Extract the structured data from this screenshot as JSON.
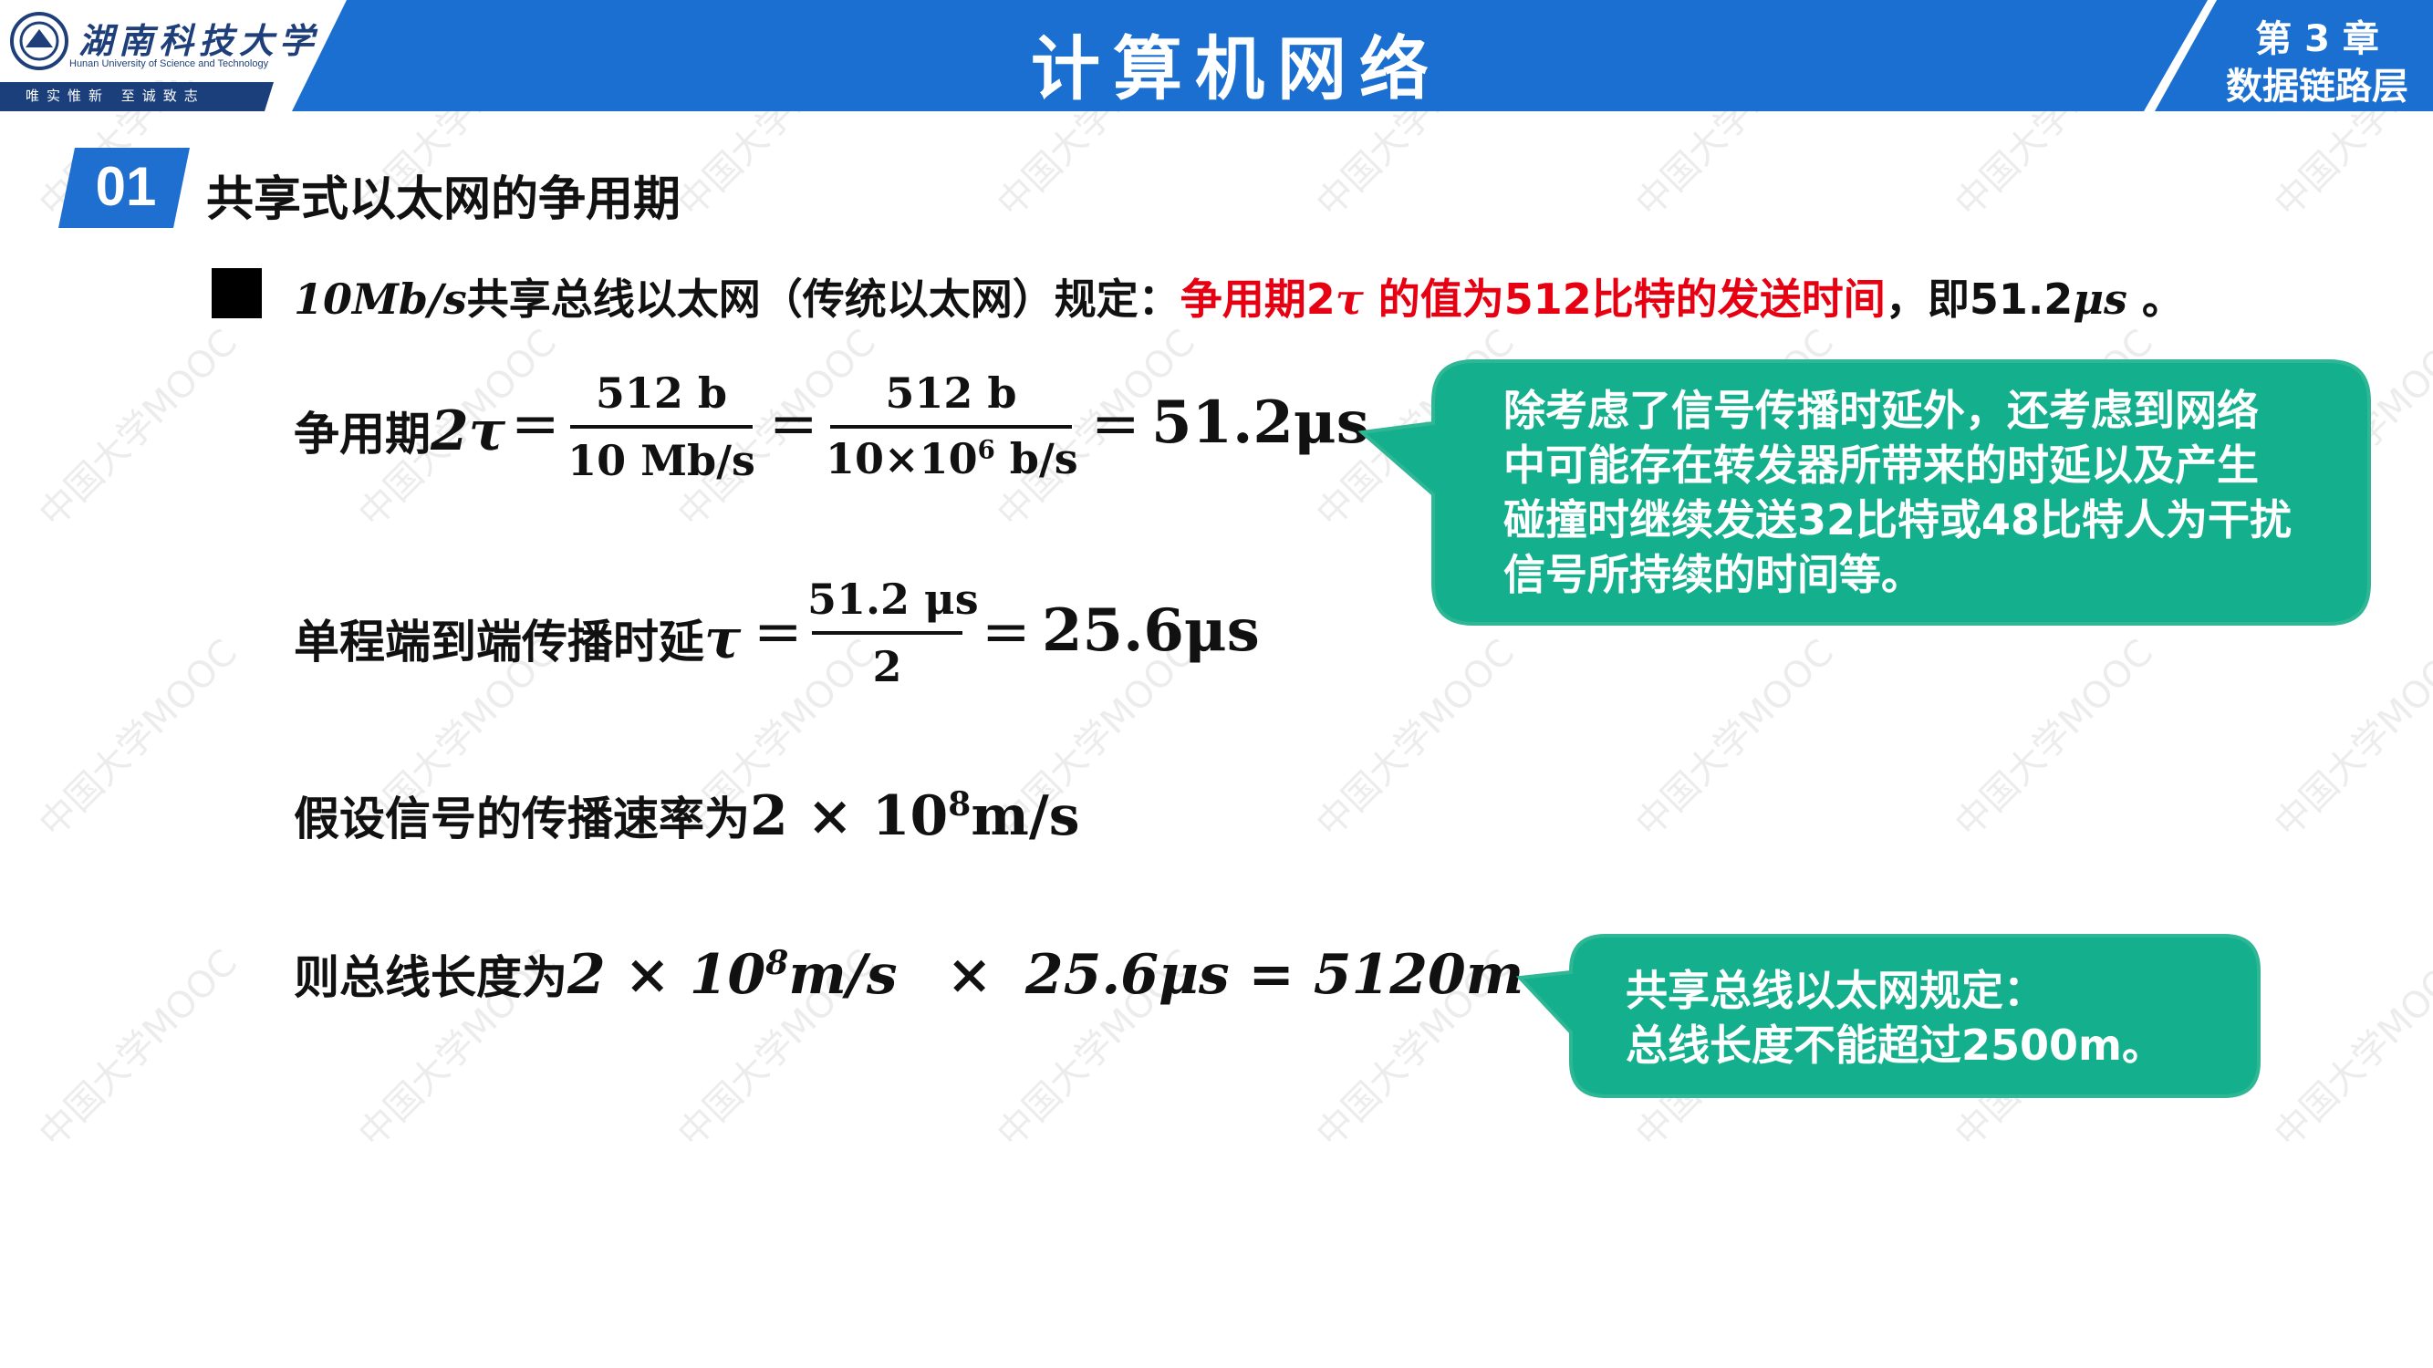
{
  "header": {
    "university_name_cn": "湖南科技大学",
    "university_name_en": "Hunan University of Science and Technology",
    "motto": "唯实惟新 至诚致志",
    "course_title": "计算机网络",
    "chapter_number": "第 3 章",
    "chapter_name": "数据链路层"
  },
  "section": {
    "number": "01",
    "title": "共享式以太网的争用期"
  },
  "bullet": {
    "prefix_math": "10Mb/s",
    "prefix_text": "共享总线以太网（传统以太网）规定：",
    "highlight_text_a": "争用期2",
    "highlight_tau": "τ",
    "highlight_text_b": " 的值为512比特的发送时间",
    "suffix_text": "，即51.2",
    "suffix_unit": "μs",
    "end": " 。"
  },
  "eq1": {
    "label": "争用期",
    "lhs": "2τ",
    "frac1_num": "512 b",
    "frac1_den": "10 Mb/s",
    "frac2_num": "512 b",
    "frac2_den_a": "10×10",
    "frac2_den_exp": "6",
    "frac2_den_b": " b/s",
    "result": "51.2μs"
  },
  "eq2": {
    "label": "单程端到端传播时延",
    "lhs": "τ",
    "frac_num": "51.2 μs",
    "frac_den": "2",
    "result": "25.6μs"
  },
  "eq3": {
    "label": "假设信号的传播速率为",
    "value_a": "2 × 10",
    "value_exp": "8",
    "value_b": "m/s"
  },
  "eq4": {
    "label": "则总线长度为",
    "value_a": "2 × 10",
    "value_exp": "8",
    "value_b": "m/s",
    "times": "×",
    "value_c": "25.6μs = 5120m"
  },
  "callout1": {
    "line1": "除考虑了信号传播时延外，还考虑到网络",
    "line2": "中可能存在转发器所带来的时延以及产生",
    "line3": "碰撞时继续发送32比特或48比特人为干扰",
    "line4": "信号所持续的时间等。"
  },
  "callout2": {
    "line1": "共享总线以太网规定：",
    "line2": "总线长度不能超过2500m。"
  },
  "watermark": "中国大学MOOC",
  "colors": {
    "header_blue": "#1a6fd0",
    "section_blue": "#1f6fd1",
    "callout_teal": "#14b08e",
    "callout_border": "#2fb795",
    "highlight_red": "#e60012"
  }
}
